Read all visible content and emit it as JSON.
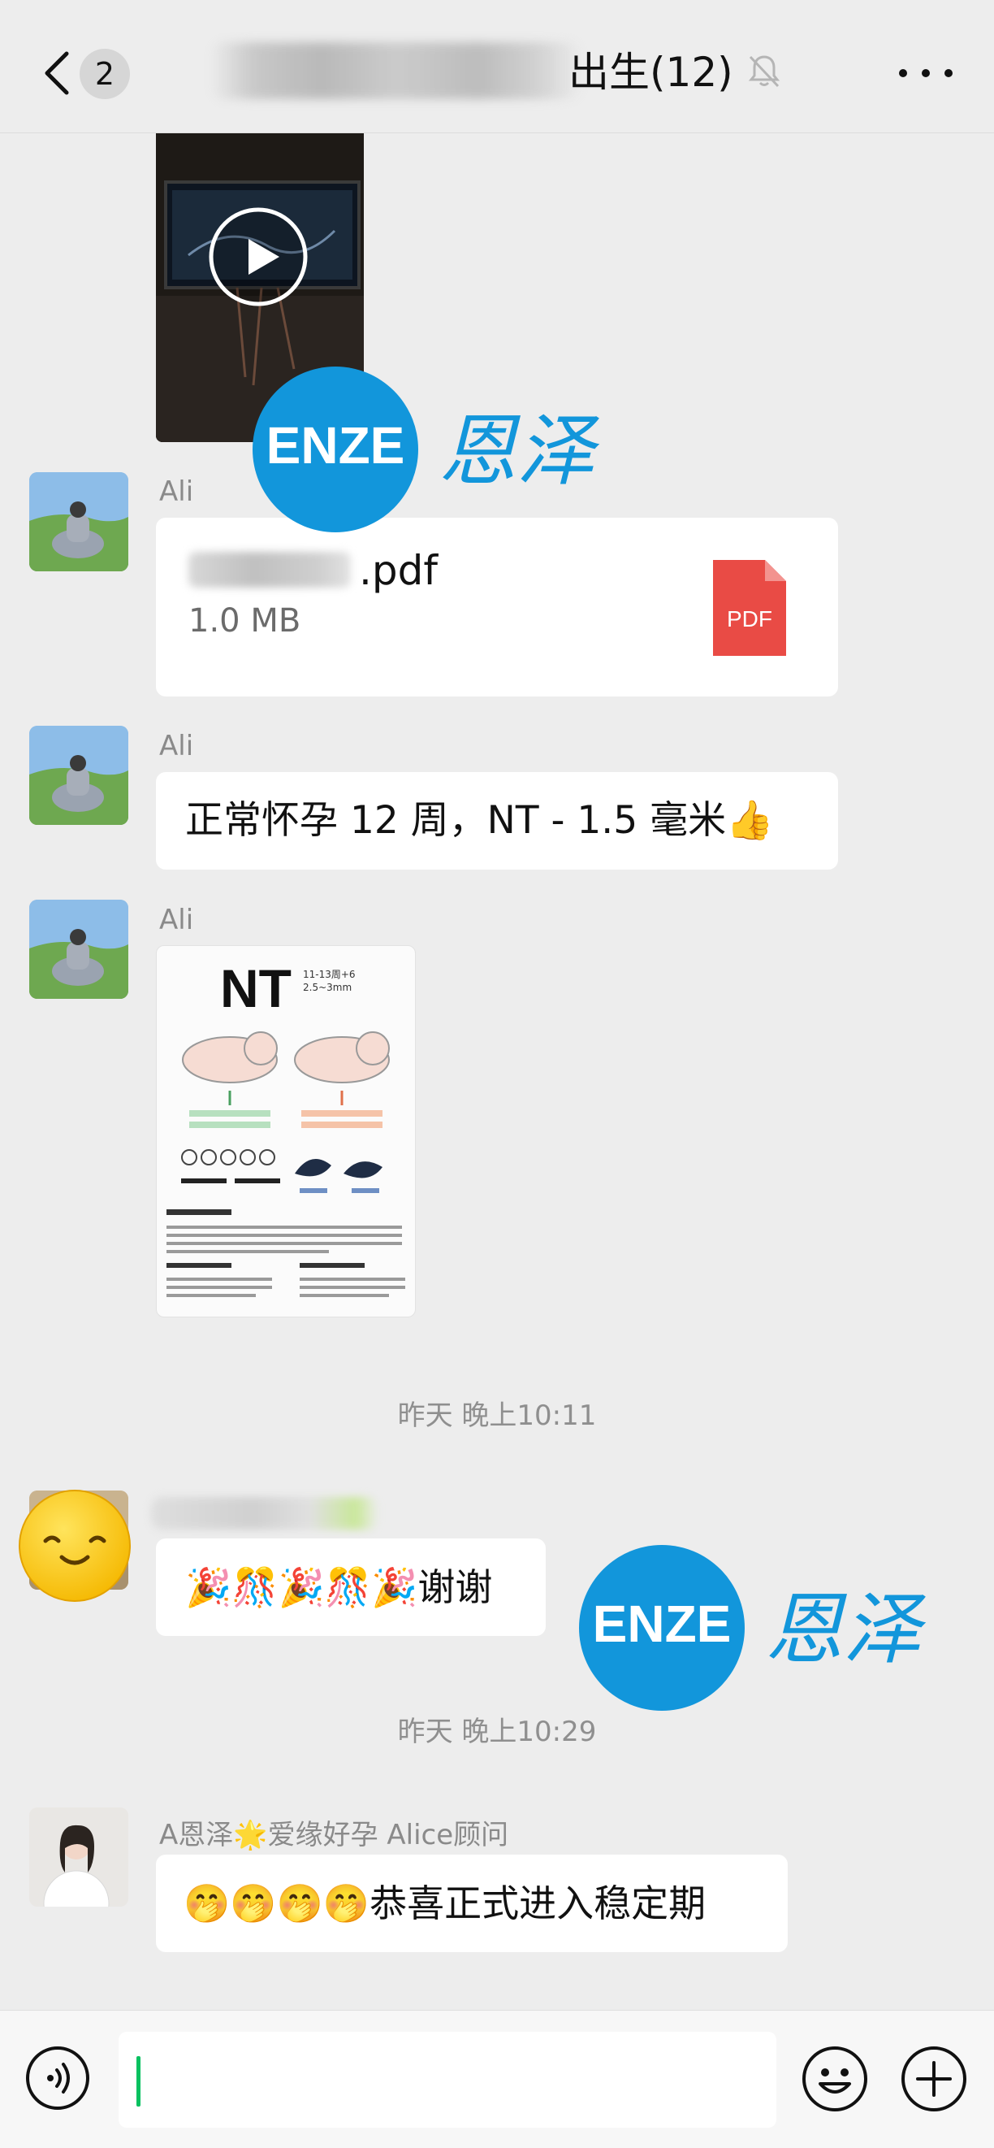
{
  "header": {
    "unread_count": "2",
    "title": "出生(12)",
    "back_icon": "chevron-left-icon",
    "mute_icon": "bell-muted-icon",
    "more_icon": "more-dots-icon"
  },
  "messages": {
    "file": {
      "sender": "Ali",
      "file_name": ".pdf",
      "file_size": "1.0 MB",
      "file_type_label": "PDF"
    },
    "text1": {
      "sender": "Ali",
      "text": "正常怀孕 12 周，NT - 1.5 毫米👍"
    },
    "image": {
      "sender": "Ali",
      "nt_title": "NT",
      "nt_sub1": "11-13周+6",
      "nt_sub2": "2.5~3mm"
    },
    "time1": "昨天 晚上10:11",
    "thanks": {
      "text": "🎉🎊🎉🎊🎉谢谢"
    },
    "time2": "昨天 晚上10:29",
    "congrats": {
      "sender": "A恩泽🌟爱缘好孕 Alice顾问",
      "text": "🤭🤭🤭🤭恭喜正式进入稳定期"
    }
  },
  "watermark": {
    "logo_text": "ENZE",
    "chinese": "恩泽"
  },
  "input_bar": {
    "value": "",
    "voice_icon": "voice-icon",
    "emoji_icon": "emoji-icon",
    "plus_icon": "plus-icon"
  },
  "colors": {
    "background": "#ededed",
    "bubble": "#ffffff",
    "accent_green": "#07c160",
    "pdf_red": "#e94b45",
    "watermark_blue": "#1296db"
  }
}
